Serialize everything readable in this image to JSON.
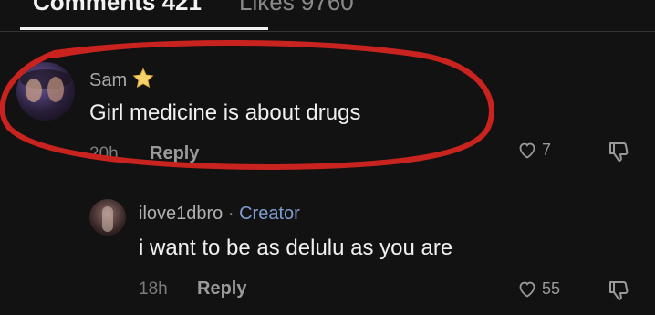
{
  "tabs": [
    {
      "label": "Comments 421"
    },
    {
      "label": "Likes 9760"
    }
  ],
  "comments": [
    {
      "username": "Sam",
      "badge_icon": "star-emoji",
      "text": "Girl medicine is about drugs",
      "time": "20h",
      "reply_label": "Reply",
      "likes": "7"
    },
    {
      "username": "ilove1dbro",
      "separator": "·",
      "tag": "Creator",
      "text": "i want to be as delulu as you are",
      "time": "18h",
      "reply_label": "Reply",
      "likes": "55"
    }
  ],
  "colors": {
    "background": "#121212",
    "creator_tag": "#7f9dcf",
    "annotation_circle": "#c8231e"
  }
}
